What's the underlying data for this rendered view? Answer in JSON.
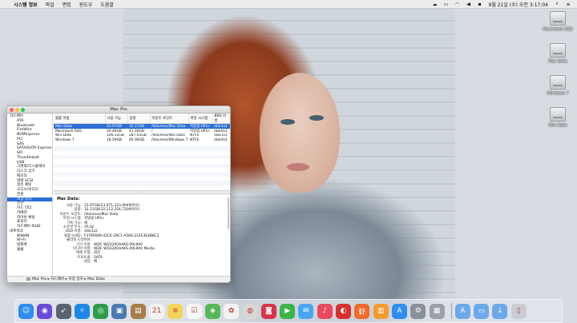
{
  "menubar": {
    "app_name": "시스템 정보",
    "items": [
      "파일",
      "편집",
      "윈도우",
      "도움말"
    ],
    "clock": "9월 21일 (수) 오전 3:17:04"
  },
  "desktop": {
    "icons": [
      "Macintosh SSD",
      "Mac Data",
      "Windows 7",
      "Win Data"
    ]
  },
  "window": {
    "title": "Mac Pro",
    "sidebar": {
      "sections": [
        {
          "label": "하드웨어",
          "items": [
            "ATA",
            "Bluetooth",
            "FireWire",
            "NVMExpress",
            "PCI",
            "SAS",
            "SATA/SATA Express",
            "SPI",
            "Thunderbolt",
            "USB",
            "그래픽/디스플레이",
            "디스크 굽기",
            "메모리",
            "병렬 SCSI",
            "섬유 채널",
            "오디오/비디오",
            "전원",
            "저장 장치",
            "진단",
            "카드 리더",
            "카메라",
            "파이버 채널",
            "프린터",
            "하드웨어 RAID"
          ]
        },
        {
          "label": "네트워크",
          "items": [
            "WWAN",
            "Wi-Fi",
            "방화벽",
            "볼륨"
          ]
        }
      ],
      "selected": "저장 장치"
    },
    "table": {
      "columns": [
        "볼륨 이름",
        "사용 가능",
        "용량",
        "마운트 포인트",
        "파일 시스템",
        "BSD 이름"
      ],
      "rows": [
        [
          "Mac Data",
          "23.97GB",
          "32.21GB",
          "/Volumes/Mac Data",
          "저널링 HFS+",
          "disk1s2"
        ],
        [
          "Macintosh SSD",
          "24.46GB",
          "41.28GB",
          "/",
          "저널링 HFS+",
          "disk0s3"
        ],
        [
          "Win Data",
          "106.32GB",
          "287.65GB",
          "/Volumes/Win Data",
          "NTFS",
          "disk1s1"
        ],
        [
          "Windows 7",
          "18.59GB",
          "85.90GB",
          "/Volumes/Windows 7",
          "NTFS",
          "disk0s2"
        ]
      ]
    },
    "detail": {
      "title": "Mac Data:",
      "fields": [
        {
          "k": "사용 가능:",
          "v": "23.97GB(23,971,323,904바이트)"
        },
        {
          "k": "용량:",
          "v": "32.21GB(32,212,254,720바이트)"
        },
        {
          "k": "마운트 포인트:",
          "v": "/Volumes/Mac Data"
        },
        {
          "k": "파일 시스템:",
          "v": "저널링 HFS+"
        },
        {
          "k": "기록 가능:",
          "v": "예"
        },
        {
          "k": "소유권 무시:",
          "v": "아니요"
        },
        {
          "k": "BSD 이름:",
          "v": "disk1s2"
        },
        {
          "k": "볼륨 UUID:",
          "v": "F376F669-42C6-39C1-A566-214E3E4B8C2"
        }
      ],
      "physical_label": "물리적 드라이브:",
      "physical_fields": [
        {
          "k": "기기 이름:",
          "v": "WDC WD3200AAKS-00L9A0"
        },
        {
          "k": "미디어 이름:",
          "v": "WDC WD3200AAKS-00L9A0 Media"
        },
        {
          "k": "매체 유형:",
          "v": "회전"
        },
        {
          "k": "프로토콜:",
          "v": "SATA"
        },
        {
          "k": "내장:",
          "v": "예"
        }
      ]
    },
    "pathbar": "Mac Pro ▸ 하드웨어 ▸ 저장 장치 ▸ Mac Data"
  },
  "dock": {
    "apps": [
      {
        "name": "finder-icon",
        "glyph": "☺",
        "color": "#2f8ef0"
      },
      {
        "name": "siri-icon",
        "glyph": "◉",
        "color": "#6a4bd8"
      },
      {
        "name": "launchpad-icon",
        "glyph": "➶",
        "color": "#5a6470"
      },
      {
        "name": "safari-icon",
        "glyph": "✧",
        "color": "#1e88e5"
      },
      {
        "name": "chrome-icon",
        "glyph": "◎",
        "color": "#2e9d49"
      },
      {
        "name": "preview-icon",
        "glyph": "▣",
        "color": "#4b7bb4"
      },
      {
        "name": "contacts-icon",
        "glyph": "▤",
        "color": "#a77b4b"
      },
      {
        "name": "calendar-icon",
        "glyph": "21",
        "color": "#f2f2f2"
      },
      {
        "name": "notes-icon",
        "glyph": "≡",
        "color": "#f3d55a"
      },
      {
        "name": "reminders-icon",
        "glyph": "☑",
        "color": "#f7f7f7"
      },
      {
        "name": "maps-icon",
        "glyph": "◈",
        "color": "#58b65a"
      },
      {
        "name": "photos-icon",
        "glyph": "✿",
        "color": "#f2f2f2"
      },
      {
        "name": "messages-icon",
        "glyph": "◍",
        "color": "#d8d8d8"
      },
      {
        "name": "photo-booth-icon",
        "glyph": "◙",
        "color": "#d9334a"
      },
      {
        "name": "facetime-icon",
        "glyph": "▶",
        "color": "#3cb54a"
      },
      {
        "name": "messages-bubble-icon",
        "glyph": "✉",
        "color": "#48a6f0"
      },
      {
        "name": "music-icon",
        "glyph": "♪",
        "color": "#e9485e"
      },
      {
        "name": "netease-music-icon",
        "glyph": "◐",
        "color": "#d63131"
      },
      {
        "name": "xiami-icon",
        "glyph": "虾",
        "color": "#f06b2a"
      },
      {
        "name": "books-icon",
        "glyph": "▥",
        "color": "#f49a2c"
      },
      {
        "name": "app-store-icon",
        "glyph": "A",
        "color": "#2f8ef0"
      },
      {
        "name": "system-preferences-icon",
        "glyph": "⚙",
        "color": "#8a9099"
      },
      {
        "name": "system-information-icon",
        "glyph": "▦",
        "color": "#9aa0a6"
      }
    ],
    "right": [
      {
        "name": "applications-folder-icon",
        "glyph": "A",
        "color": "#6da8e8"
      },
      {
        "name": "documents-folder-icon",
        "glyph": "▭",
        "color": "#6da8e8"
      },
      {
        "name": "downloads-folder-icon",
        "glyph": "↓",
        "color": "#6da8e8"
      },
      {
        "name": "trash-icon",
        "glyph": "▯",
        "color": "#c9ced4"
      }
    ]
  }
}
